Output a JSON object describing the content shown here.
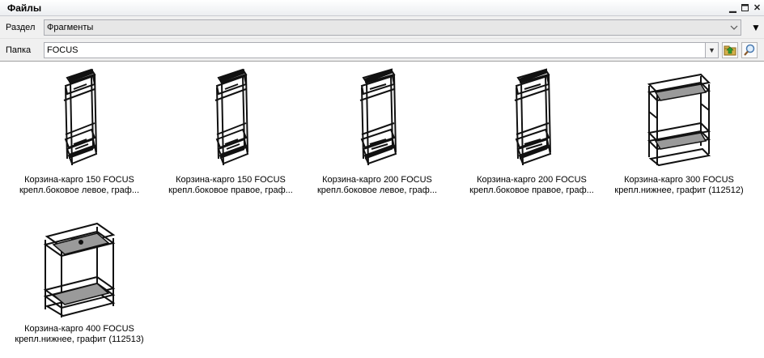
{
  "panel": {
    "title": "Файлы"
  },
  "section": {
    "label": "Раздел",
    "value": "Фрагменты"
  },
  "folder": {
    "label": "Папка",
    "value": "FOCUS"
  },
  "files": [
    {
      "line1": "Корзина-карго 150 FOCUS",
      "line2": "крепл.боковое левое, граф..."
    },
    {
      "line1": "Корзина-карго 150 FOCUS",
      "line2": "крепл.боковое правое, граф..."
    },
    {
      "line1": "Корзина-карго 200 FOCUS",
      "line2": "крепл.боковое левое, граф..."
    },
    {
      "line1": "Корзина-карго 200 FOCUS",
      "line2": "крепл.боковое правое, граф..."
    },
    {
      "line1": "Корзина-карго 300 FOCUS",
      "line2": "крепл.нижнее, графит (112512)"
    },
    {
      "line1": "Корзина-карго 400 FOCUS",
      "line2": "крепл.нижнее, графит (112513)"
    }
  ]
}
